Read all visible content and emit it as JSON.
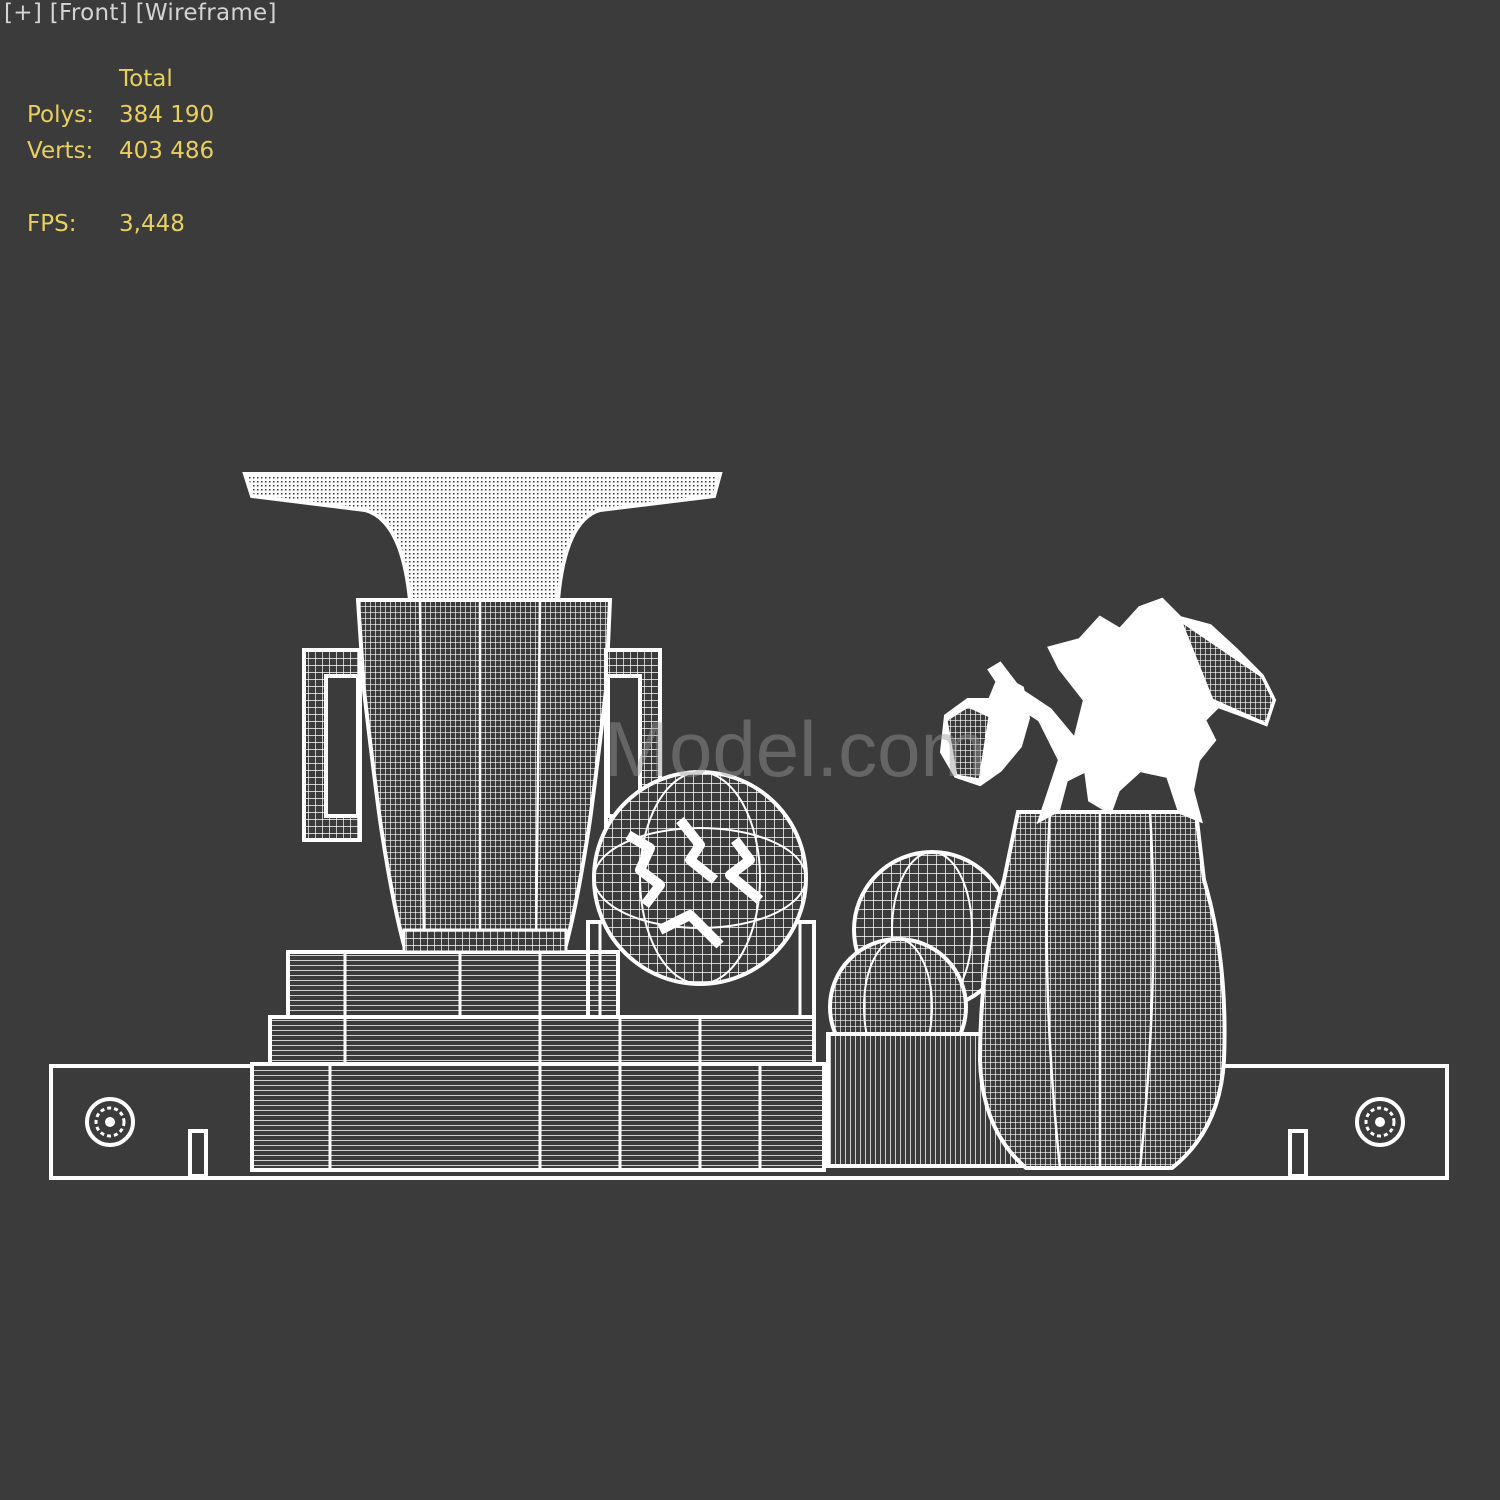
{
  "viewport": {
    "plus_label": "[+]",
    "view_label": "[Front]",
    "shading_label": "[Wireframe]"
  },
  "stats": {
    "header": "Total",
    "polys_label": "Polys:",
    "polys_value": "384 190",
    "verts_label": "Verts:",
    "verts_value": "403 486",
    "fps_label": "FPS:",
    "fps_value": "3,448"
  },
  "watermark": "Model.com",
  "colors": {
    "background": "#3b3b3b",
    "wireframe": "#ffffff",
    "stats_text": "#e8d060",
    "menu_text": "#d4d4d4"
  }
}
